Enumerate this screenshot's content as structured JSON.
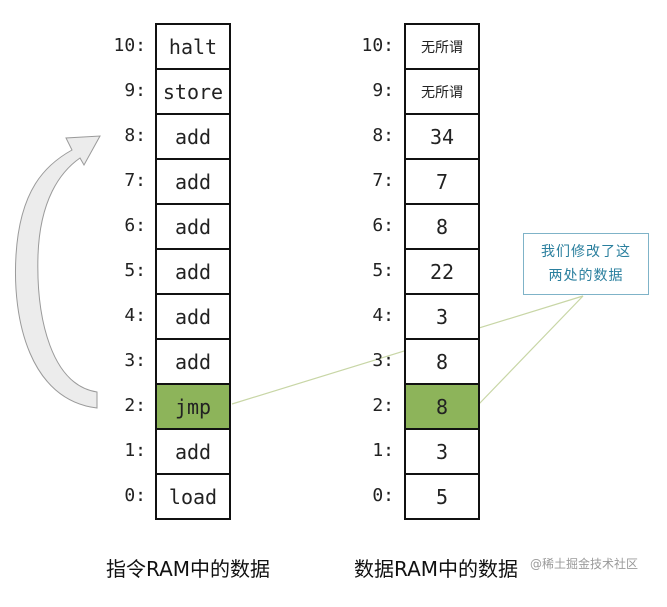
{
  "instruction_ram": {
    "caption": "指令RAM中的数据",
    "cells": [
      {
        "addr": "10:",
        "value": "halt"
      },
      {
        "addr": "9:",
        "value": "store"
      },
      {
        "addr": "8:",
        "value": "add"
      },
      {
        "addr": "7:",
        "value": "add"
      },
      {
        "addr": "6:",
        "value": "add"
      },
      {
        "addr": "5:",
        "value": "add"
      },
      {
        "addr": "4:",
        "value": "add"
      },
      {
        "addr": "3:",
        "value": "add"
      },
      {
        "addr": "2:",
        "value": "jmp",
        "highlight": true
      },
      {
        "addr": "1:",
        "value": "add"
      },
      {
        "addr": "0:",
        "value": "load"
      }
    ]
  },
  "data_ram": {
    "caption": "数据RAM中的数据",
    "cells": [
      {
        "addr": "10:",
        "value": "无所谓",
        "small": true
      },
      {
        "addr": "9:",
        "value": "无所谓",
        "small": true
      },
      {
        "addr": "8:",
        "value": "34"
      },
      {
        "addr": "7:",
        "value": "7"
      },
      {
        "addr": "6:",
        "value": "8"
      },
      {
        "addr": "5:",
        "value": "22"
      },
      {
        "addr": "4:",
        "value": "3"
      },
      {
        "addr": "3:",
        "value": "8"
      },
      {
        "addr": "2:",
        "value": "8",
        "highlight": true
      },
      {
        "addr": "1:",
        "value": "3"
      },
      {
        "addr": "0:",
        "value": "5"
      }
    ]
  },
  "callout": {
    "line1": "我们修改了这",
    "line2": "两处的数据"
  },
  "watermark": "@稀土掘金技术社区",
  "colors": {
    "highlight": "#8db45a",
    "callout_border": "#7fb3c8",
    "callout_text": "#2a7f9e",
    "arrow_fill": "#ececec"
  }
}
